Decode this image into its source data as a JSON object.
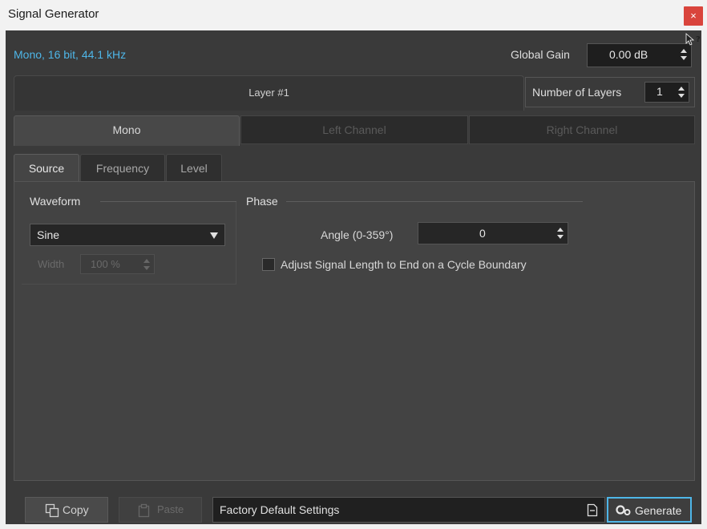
{
  "window": {
    "title": "Signal Generator",
    "close_glyph": "×"
  },
  "header": {
    "format": "Mono, 16 bit, 44.1 kHz",
    "global_gain_label": "Global Gain",
    "global_gain_value": "0.00 dB"
  },
  "layer": {
    "title": "Layer #1",
    "number_label": "Number of Layers",
    "number_value": "1"
  },
  "channel_tabs": [
    {
      "label": "Mono",
      "active": true
    },
    {
      "label": "Left Channel",
      "active": false
    },
    {
      "label": "Right Channel",
      "active": false
    }
  ],
  "sub_tabs": [
    {
      "label": "Source",
      "active": true
    },
    {
      "label": "Frequency",
      "active": false
    },
    {
      "label": "Level",
      "active": false
    }
  ],
  "waveform": {
    "label": "Waveform",
    "selected": "Sine",
    "width_label": "Width",
    "width_value": "100 %"
  },
  "phase": {
    "label": "Phase",
    "angle_label": "Angle (0-359°)",
    "angle_value": "0",
    "adjust_label": "Adjust Signal Length to End on a Cycle Boundary",
    "adjust_checked": false
  },
  "footer": {
    "copy_label": "Copy",
    "paste_label": "Paste",
    "preset_value": "Factory Default Settings",
    "generate_label": "Generate"
  },
  "colors": {
    "accent": "#4eb6e8",
    "close": "#d9443c",
    "background": "#3a3a3a"
  }
}
